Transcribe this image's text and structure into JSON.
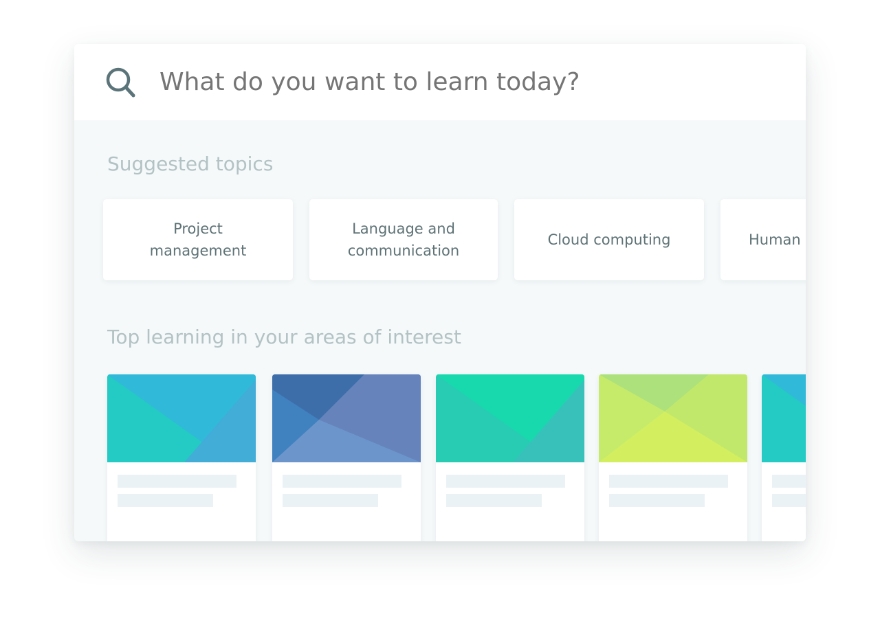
{
  "search": {
    "placeholder": "What do you want to learn today?",
    "icon": "search-icon",
    "icon_color": "#5b7479"
  },
  "suggested": {
    "title": "Suggested topics",
    "topics": [
      {
        "label": "Project\nmanagement"
      },
      {
        "label": "Language and\ncommunication"
      },
      {
        "label": "Cloud computing"
      },
      {
        "label": "Human"
      }
    ]
  },
  "interest": {
    "title": "Top learning in your areas of interest",
    "courses": [
      {
        "palette": {
          "base": "#24cac4",
          "top": "#31b7da",
          "accent": "#46aad8"
        }
      },
      {
        "palette": {
          "base": "#4081bf",
          "top": "#3d6ea9",
          "accent": "#6683bc"
        }
      },
      {
        "palette": {
          "base": "#28ccb2",
          "top": "#16d9ad",
          "accent": "#3ac0bb"
        }
      },
      {
        "palette": {
          "base": "#d3ef60",
          "top": "#ade17b",
          "accent": "#c5ea6c"
        }
      },
      {
        "palette": {
          "base": "#24cac4",
          "top": "#31b7da",
          "accent": "#46aad8"
        }
      }
    ]
  },
  "colors": {
    "panel_background": "#f5f9fa",
    "title_text": "#b3c2c4",
    "topic_text": "#5e7276",
    "placeholder_text": "#878d8f",
    "skeleton": "#ebf2f5"
  }
}
